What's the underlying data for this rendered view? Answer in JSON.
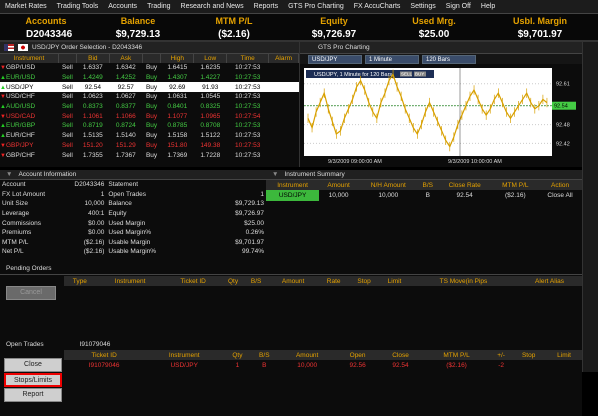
{
  "menu": [
    "Market Rates",
    "Trading Tools",
    "Accounts",
    "Trading",
    "Research and News",
    "Reports",
    "GTS Pro Charting",
    "FX AccuCharts",
    "Settings",
    "Sign Off",
    "Help"
  ],
  "account_bar": {
    "headers": [
      "Accounts",
      "Balance",
      "MTM P/L",
      "Equity",
      "Used Mrg.",
      "Usbl. Margin"
    ],
    "values": [
      "D2043346",
      "$9,729.13",
      "($2.16)",
      "$9,726.97",
      "$25.00",
      "$9,701.97"
    ]
  },
  "quote_panel": {
    "title": "USD/JPY Order Selection - D2043346",
    "columns": [
      "Instrument",
      "Bid",
      "Ask",
      "",
      "High",
      "Low",
      "Time",
      "Alarm"
    ],
    "rows": [
      {
        "instrument": "GBP/USD",
        "sell": "Sell",
        "bid": "1.6337",
        "ask": "1.6342",
        "buy": "Buy",
        "high": "1.6415",
        "low": "1.6235",
        "time": "10:27:53",
        "dir": "dn",
        "style": ""
      },
      {
        "instrument": "EUR/USD",
        "sell": "Sell",
        "bid": "1.4249",
        "ask": "1.4252",
        "buy": "Buy",
        "high": "1.4307",
        "low": "1.4227",
        "time": "10:27:53",
        "dir": "up",
        "style": "grn"
      },
      {
        "instrument": "USD/JPY",
        "sell": "Sell",
        "bid": "92.54",
        "ask": "92.57",
        "buy": "Buy",
        "high": "92.69",
        "low": "91.93",
        "time": "10:27:53",
        "dir": "up",
        "style": "sel"
      },
      {
        "instrument": "USD/CHF",
        "sell": "Sell",
        "bid": "1.0623",
        "ask": "1.0627",
        "buy": "Buy",
        "high": "1.0631",
        "low": "1.0545",
        "time": "10:27:53",
        "dir": "dn",
        "style": ""
      },
      {
        "instrument": "AUD/USD",
        "sell": "Sell",
        "bid": "0.8373",
        "ask": "0.8377",
        "buy": "Buy",
        "high": "0.8401",
        "low": "0.8325",
        "time": "10:27:53",
        "dir": "up",
        "style": "grn"
      },
      {
        "instrument": "USD/CAD",
        "sell": "Sell",
        "bid": "1.1061",
        "ask": "1.1066",
        "buy": "Buy",
        "high": "1.1077",
        "low": "1.0965",
        "time": "10:27:54",
        "dir": "dn",
        "style": "red"
      },
      {
        "instrument": "EUR/GBP",
        "sell": "Sell",
        "bid": "0.8719",
        "ask": "0.8724",
        "buy": "Buy",
        "high": "0.8785",
        "low": "0.8708",
        "time": "10:27:53",
        "dir": "up",
        "style": "grn"
      },
      {
        "instrument": "EUR/CHF",
        "sell": "Sell",
        "bid": "1.5135",
        "ask": "1.5140",
        "buy": "Buy",
        "high": "1.5158",
        "low": "1.5122",
        "time": "10:27:53",
        "dir": "up",
        "style": ""
      },
      {
        "instrument": "GBP/JPY",
        "sell": "Sell",
        "bid": "151.20",
        "ask": "151.29",
        "buy": "Buy",
        "high": "151.80",
        "low": "149.38",
        "time": "10:27:53",
        "dir": "dn",
        "style": "red"
      },
      {
        "instrument": "GBP/CHF",
        "sell": "Sell",
        "bid": "1.7355",
        "ask": "1.7367",
        "buy": "Buy",
        "high": "1.7369",
        "low": "1.7228",
        "time": "10:27:53",
        "dir": "dn",
        "style": ""
      }
    ]
  },
  "chart": {
    "title": "GTS Pro Charting",
    "symbol": "USD/JPY",
    "interval": "1 Minute",
    "bars": "120 Bars",
    "legend": "USD/JPY, 1 Minute for 120 Bars",
    "legend_tags": [
      "SELL",
      "BUY"
    ],
    "y_ticks": [
      "92.61",
      "92.54",
      "92.48",
      "92.42"
    ],
    "current_price": "92.54",
    "x_labels": [
      "9/3/2009 09:00:00 AM",
      "9/3/2009 10:00:00 AM"
    ],
    "series_color": "#d8a000"
  },
  "account_info": {
    "title": "Account Information",
    "rows": [
      [
        "Account",
        "D2043346",
        "Statement",
        ""
      ],
      [
        "FX Lot Amount",
        "1",
        "Open Trades",
        "1"
      ],
      [
        "Unit Size",
        "10,000",
        "Balance",
        "$9,729.13"
      ],
      [
        "Leverage",
        "400:1",
        "Equity",
        "$9,726.97"
      ],
      [
        "Commissions",
        "$0.00",
        "Used Margin",
        "$25.00"
      ],
      [
        "Premiums",
        "$0.00",
        "Used Margin%",
        "0.26%"
      ],
      [
        "MTM P/L",
        "($2.16)",
        "Usable Margin",
        "$9,701.97"
      ],
      [
        "Net P/L",
        "($2.16)",
        "Usable Margin%",
        "99.74%"
      ]
    ]
  },
  "instrument_summary": {
    "title": "Instrument Summary",
    "columns": [
      "Instrument",
      "Amount",
      "N/H Amount",
      "B/S",
      "Close Rate",
      "MTM P/L",
      "Action"
    ],
    "rows": [
      [
        "USD/JPY",
        "10,000",
        "10,000",
        "B",
        "92.54",
        "($2.16)",
        "Close All"
      ]
    ]
  },
  "pending": {
    "title": "Pending Orders",
    "columns": [
      "Type",
      "Instrument",
      "Ticket ID",
      "Qty",
      "B/S",
      "Amount",
      "Rate",
      "Stop",
      "Limit",
      "TS Move(in Pips",
      "Alert Alias"
    ],
    "cancel_label": "Cancel"
  },
  "open_trades": {
    "title": "Open Trades",
    "id": "I91079046",
    "columns": [
      "Ticket ID",
      "Instrument",
      "Qty",
      "B/S",
      "Amount",
      "Open",
      "Close",
      "MTM P/L",
      "+/-",
      "Stop",
      "Limit"
    ],
    "rows": [
      [
        "I91079046",
        "USD/JPY",
        "1",
        "B",
        "10,000",
        "92.56",
        "92.54",
        "($2.16)",
        "-2",
        "",
        ""
      ]
    ],
    "buttons": [
      "Close",
      "Stops/Limits",
      "Report"
    ]
  }
}
